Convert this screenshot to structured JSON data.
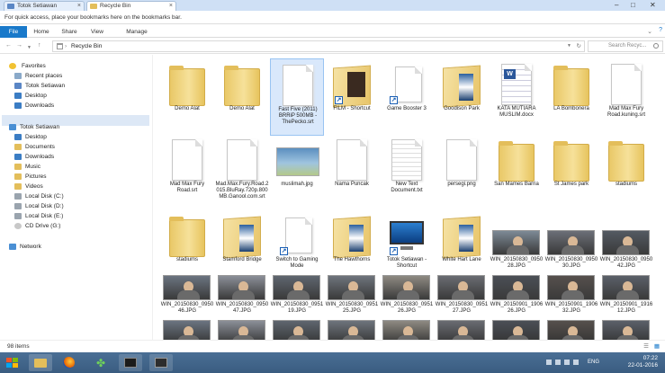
{
  "browser": {
    "tabs": [
      {
        "label": "Totok Setiawan",
        "active": false
      },
      {
        "label": "Recycle Bin",
        "active": true
      }
    ],
    "bookmarks_hint": "For quick access, place your bookmarks here on the bookmarks bar."
  },
  "ribbon": {
    "file": "File",
    "home": "Home",
    "share": "Share",
    "view": "View",
    "manage": "Manage"
  },
  "address": {
    "path": "Recycle Bin",
    "search_placeholder": "Search Recyc..."
  },
  "nav": {
    "favorites": "Favorites",
    "recent": "Recent places",
    "totok_fav": "Totok Setiawan",
    "desktop": "Desktop",
    "downloads": "Downloads",
    "user": "Totok Setiawan",
    "u_desktop": "Desktop",
    "u_documents": "Documents",
    "u_downloads": "Downloads",
    "u_music": "Music",
    "u_pictures": "Pictures",
    "u_videos": "Videos",
    "disk_c": "Local Disk (C:)",
    "disk_d": "Local Disk (D:)",
    "disk_e": "Local Disk (E:)",
    "cd_g": "CD Drive (G:)",
    "network": "Network"
  },
  "items": [
    {
      "label": "Demo Alat",
      "kind": "folder"
    },
    {
      "label": "Demo Alat",
      "kind": "folder"
    },
    {
      "label": "Fast Five (2011) BRRiP 500MB - ThePecko.srt",
      "kind": "doc",
      "selected": true
    },
    {
      "label": "FILM - Shortcut",
      "kind": "folder-shortcut"
    },
    {
      "label": "Game Booster 3",
      "kind": "doc-shortcut"
    },
    {
      "label": "Goodison Park",
      "kind": "folder-open"
    },
    {
      "label": "KATA MUTIARA MUSLIM.docx",
      "kind": "word"
    },
    {
      "label": "LA Bombonera",
      "kind": "folder"
    },
    {
      "label": "Mad Max Fury Road.kuning.srt",
      "kind": "doc"
    },
    {
      "label": "Mad Max Fury Road.srt",
      "kind": "doc"
    },
    {
      "label": "Mad.Max.Fury.Road.2015.BluRay.720p.800MB.Ganool.com.srt",
      "kind": "doc"
    },
    {
      "label": "muslimah.jpg",
      "kind": "image"
    },
    {
      "label": "Nama Puncak",
      "kind": "doc"
    },
    {
      "label": "New Text Document.txt",
      "kind": "txt"
    },
    {
      "label": "persegi.png",
      "kind": "doc"
    },
    {
      "label": "San Mames Barria",
      "kind": "folder"
    },
    {
      "label": "St James park",
      "kind": "folder"
    },
    {
      "label": "stadiums",
      "kind": "folder"
    },
    {
      "label": "stadiums",
      "kind": "folder"
    },
    {
      "label": "Stamford Bridge",
      "kind": "folder-open"
    },
    {
      "label": "Switch to Gaming Mode",
      "kind": "doc-shortcut"
    },
    {
      "label": "The Hawthorns",
      "kind": "folder-open"
    },
    {
      "label": "Totok Setiawan - Shortcut",
      "kind": "pc-shortcut"
    },
    {
      "label": "White Hart Lane",
      "kind": "folder-open"
    }
  ],
  "thumbs": [
    "WIN_20150830_095028.JPG",
    "WIN_20150830_095030.JPG",
    "WIN_20150830_095042.JPG",
    "WIN_20150830_095046.JPG",
    "WIN_20150830_095047.JPG",
    "WIN_20150830_095119.JPG",
    "WIN_20150830_095125.JPG",
    "WIN_20150830_095126.JPG",
    "WIN_20150830_095127.JPG",
    "WIN_20150901_190626.JPG",
    "WIN_20150901_190632.JPG",
    "WIN_20150901_191612.JPG"
  ],
  "status": {
    "count": "98 items"
  },
  "tray": {
    "lang": "ENG",
    "time": "07:22",
    "date": "22-01-2016"
  },
  "colors": {
    "accent": "#1979ca",
    "selection": "#d9e8fb",
    "taskbar": "#3a5c80"
  }
}
